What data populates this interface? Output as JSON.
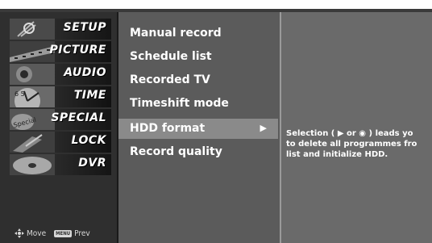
{
  "categories": [
    {
      "label": "SETUP",
      "icon": "satellite-dish-icon"
    },
    {
      "label": "PICTURE",
      "icon": "film-strip-icon"
    },
    {
      "label": "AUDIO",
      "icon": "speaker-icon"
    },
    {
      "label": "TIME",
      "icon": "clock-icon"
    },
    {
      "label": "SPECIAL",
      "icon": "special-badge-icon"
    },
    {
      "label": "LOCK",
      "icon": "padlock-icon"
    },
    {
      "label": "DVR",
      "icon": "disc-icon"
    }
  ],
  "footer": {
    "move_label": "Move",
    "prev_label": "Prev",
    "menu_key": "MENU"
  },
  "menu_items": [
    {
      "label": "Manual record"
    },
    {
      "label": "Schedule list"
    },
    {
      "label": "Recorded TV"
    },
    {
      "label": "Timeshift mode"
    },
    {
      "label": "HDD format",
      "selected": true,
      "arrow": "▶"
    },
    {
      "label": "Record quality"
    }
  ],
  "info_text": "Selection ( ▶ or ◉ ) leads yo\nto delete all programmes fro\nlist and initialize HDD."
}
